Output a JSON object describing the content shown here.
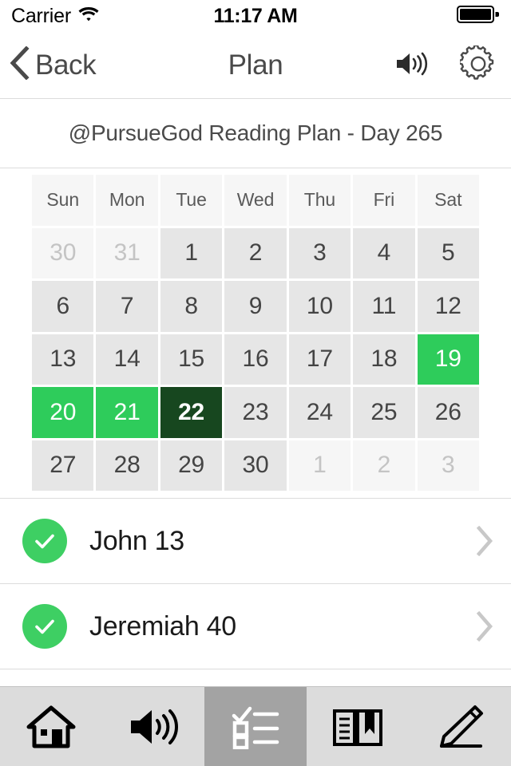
{
  "status_bar": {
    "carrier": "Carrier",
    "wifi_icon": "wifi-icon",
    "time": "11:17 AM",
    "battery_icon": "battery-full-icon"
  },
  "nav_bar": {
    "back_label": "Back",
    "back_icon": "chevron-left-icon",
    "title": "Plan",
    "actions": [
      {
        "icon": "speaker-volume-icon",
        "name": "audio-button"
      },
      {
        "icon": "gear-icon",
        "name": "settings-button"
      }
    ]
  },
  "plan_header": {
    "title": "@PursueGod Reading Plan - Day 265"
  },
  "calendar": {
    "weekdays": [
      "Sun",
      "Mon",
      "Tue",
      "Wed",
      "Thu",
      "Fri",
      "Sat"
    ],
    "colors": {
      "cell_default": "#e6e6e6",
      "cell_muted": "#f6f6f6",
      "cell_completed": "#2ecc5b",
      "cell_today": "#17471f",
      "text_default": "#444444",
      "text_muted": "#c4c4c4"
    },
    "days": [
      {
        "label": "30",
        "state": "muted"
      },
      {
        "label": "31",
        "state": "muted"
      },
      {
        "label": "1",
        "state": "normal"
      },
      {
        "label": "2",
        "state": "normal"
      },
      {
        "label": "3",
        "state": "normal"
      },
      {
        "label": "4",
        "state": "normal"
      },
      {
        "label": "5",
        "state": "normal"
      },
      {
        "label": "6",
        "state": "normal"
      },
      {
        "label": "7",
        "state": "normal"
      },
      {
        "label": "8",
        "state": "normal"
      },
      {
        "label": "9",
        "state": "normal"
      },
      {
        "label": "10",
        "state": "normal"
      },
      {
        "label": "11",
        "state": "normal"
      },
      {
        "label": "12",
        "state": "normal"
      },
      {
        "label": "13",
        "state": "normal"
      },
      {
        "label": "14",
        "state": "normal"
      },
      {
        "label": "15",
        "state": "normal"
      },
      {
        "label": "16",
        "state": "normal"
      },
      {
        "label": "17",
        "state": "normal"
      },
      {
        "label": "18",
        "state": "normal"
      },
      {
        "label": "19",
        "state": "completed"
      },
      {
        "label": "20",
        "state": "completed"
      },
      {
        "label": "21",
        "state": "completed"
      },
      {
        "label": "22",
        "state": "today"
      },
      {
        "label": "23",
        "state": "normal"
      },
      {
        "label": "24",
        "state": "normal"
      },
      {
        "label": "25",
        "state": "normal"
      },
      {
        "label": "26",
        "state": "normal"
      },
      {
        "label": "27",
        "state": "normal"
      },
      {
        "label": "28",
        "state": "normal"
      },
      {
        "label": "29",
        "state": "normal"
      },
      {
        "label": "30",
        "state": "normal"
      },
      {
        "label": "1",
        "state": "muted"
      },
      {
        "label": "2",
        "state": "muted"
      },
      {
        "label": "3",
        "state": "muted"
      }
    ]
  },
  "reading_list": {
    "items": [
      {
        "label": "John 13",
        "check_icon": "check-circle-icon",
        "chevron_icon": "chevron-right-icon",
        "completed": true
      },
      {
        "label": "Jeremiah 40",
        "check_icon": "check-circle-icon",
        "chevron_icon": "chevron-right-icon",
        "completed": true
      }
    ]
  },
  "tab_bar": {
    "active_index": 2,
    "active_background": "#a3a3a3",
    "background": "#dcdcdc",
    "tabs": [
      {
        "name": "tab-home",
        "icon": "home-icon",
        "active": false
      },
      {
        "name": "tab-audio",
        "icon": "speaker-volume-icon",
        "active": false
      },
      {
        "name": "tab-plan",
        "icon": "checklist-icon",
        "active": true
      },
      {
        "name": "tab-read",
        "icon": "book-bookmark-icon",
        "active": false
      },
      {
        "name": "tab-notes",
        "icon": "pencil-icon",
        "active": false
      }
    ]
  }
}
